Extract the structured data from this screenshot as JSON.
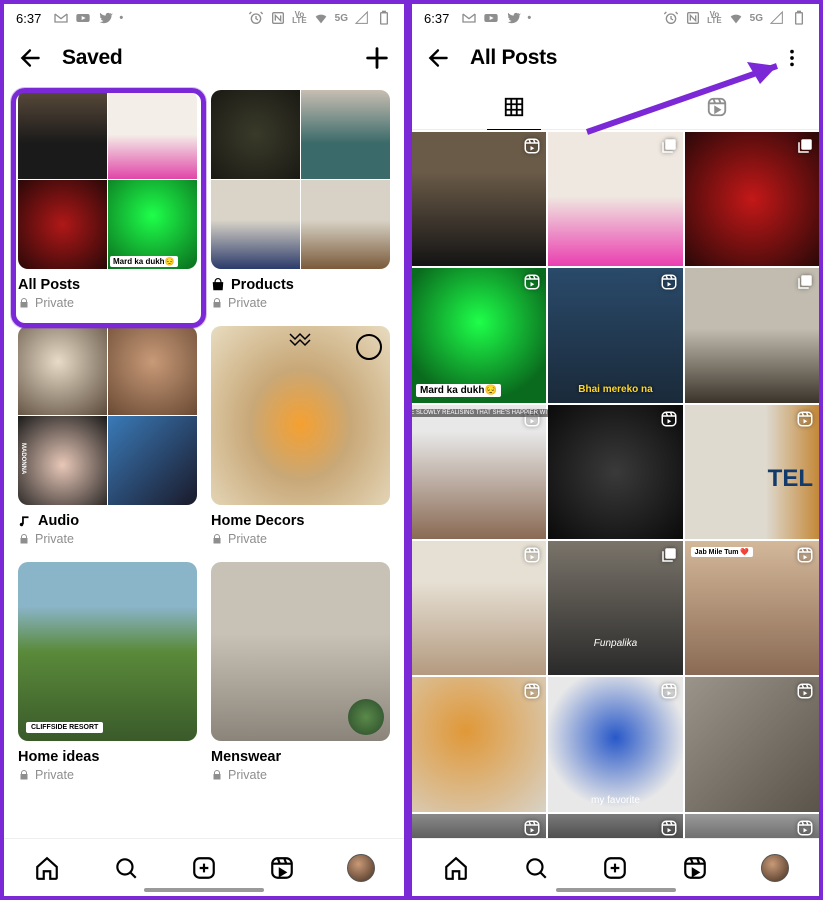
{
  "status": {
    "time": "6:37",
    "net": "5G"
  },
  "left": {
    "header": {
      "title": "Saved"
    },
    "collections": [
      {
        "name": "All Posts",
        "privacy": "Private",
        "tag": "Mard ka dukh😔",
        "thumbs": [
          "car",
          "pink-counter",
          "armor",
          "green-face"
        ]
      },
      {
        "name": "Products",
        "privacy": "Private",
        "icon": "bag",
        "thumbs": [
          "bag-olive",
          "bag-teal",
          "bag-blue",
          "bag-brown"
        ]
      },
      {
        "name": "Audio",
        "privacy": "Private",
        "icon": "music",
        "thumbs": [
          "anime-head",
          "sunglasses-man",
          "madonna",
          "gta"
        ]
      },
      {
        "name": "Home Decors",
        "privacy": "Private",
        "single": true,
        "thumbs": [
          "lamp"
        ]
      },
      {
        "name": "Home ideas",
        "privacy": "Private",
        "single": true,
        "badge": "CLIFFSIDE RESORT",
        "thumbs": [
          "cliff"
        ]
      },
      {
        "name": "Menswear",
        "privacy": "Private",
        "single": true,
        "thumbs": [
          "street-man"
        ]
      }
    ]
  },
  "right": {
    "header": {
      "title": "All Posts"
    },
    "posts": [
      {
        "bg": "car",
        "badge": "reel"
      },
      {
        "bg": "pink-counter",
        "badge": "multi"
      },
      {
        "bg": "armor",
        "badge": "multi"
      },
      {
        "bg": "green-face",
        "badge": "reel",
        "caption": "Mard ka dukh😔"
      },
      {
        "bg": "room-guy",
        "badge": "reel",
        "ytxt": "Bhai mereko na"
      },
      {
        "bg": "bike",
        "badge": "multi"
      },
      {
        "bg": "pov",
        "badge": "reel",
        "tinytop": "POV: YOU'RE SLOWLY REALISING THAT SHE'S HAPPIER WITHOUT YOU"
      },
      {
        "bg": "mirror-dark",
        "badge": "reel"
      },
      {
        "bg": "tel",
        "badge": "reel",
        "brand": "TEL"
      },
      {
        "bg": "young-man",
        "badge": "reel"
      },
      {
        "bg": "collage",
        "badge": "multi",
        "wbg": "Funpalika"
      },
      {
        "bg": "couple",
        "badge": "reel",
        "pill": "Jab Mile Tum ❤️"
      },
      {
        "bg": "food",
        "badge": "reel"
      },
      {
        "bg": "globe",
        "badge": "reel",
        "wtxt": "my favorite"
      },
      {
        "bg": "rock",
        "badge": "reel"
      },
      {
        "bg": "sliver1",
        "badge": "reel"
      },
      {
        "bg": "sliver2",
        "badge": "reel"
      },
      {
        "bg": "sliver3",
        "badge": "reel"
      }
    ]
  }
}
